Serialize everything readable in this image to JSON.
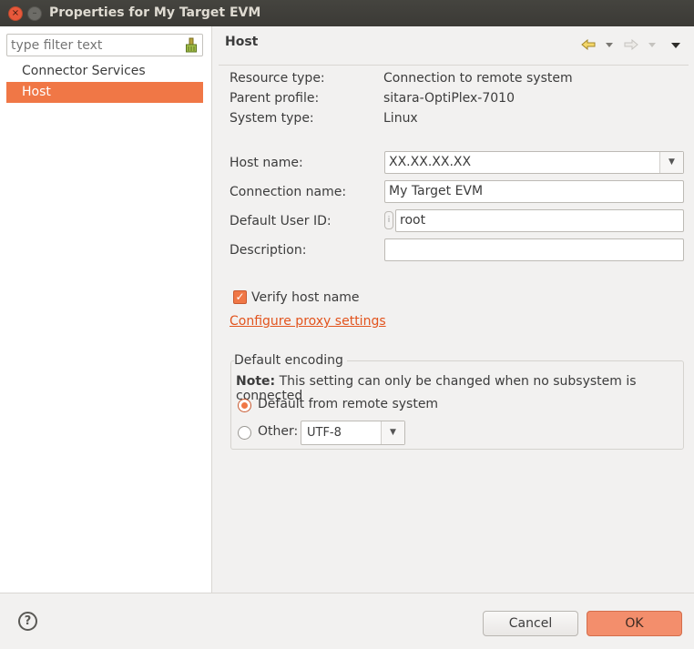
{
  "window": {
    "title": "Properties for My Target EVM",
    "close_glyph": "×",
    "minimize_glyph": "–"
  },
  "sidebar": {
    "filter_placeholder": "type filter text",
    "items": [
      {
        "label": "Connector Services",
        "selected": false
      },
      {
        "label": "Host",
        "selected": true
      }
    ]
  },
  "page": {
    "title": "Host",
    "nav_icons": [
      "back-arrow-icon",
      "dropdown-icon",
      "forward-arrow-icon",
      "dropdown-icon",
      "menu-icon"
    ]
  },
  "info": {
    "resource_type_label": "Resource type:",
    "resource_type_value": "Connection to remote system",
    "parent_profile_label": "Parent profile:",
    "parent_profile_value": "sitara-OptiPlex-7010",
    "system_type_label": "System type:",
    "system_type_value": "Linux"
  },
  "form": {
    "host_name_label": "Host name:",
    "host_name_value": "XX.XX.XX.XX",
    "connection_name_label": "Connection name:",
    "connection_name_value": "My Target EVM",
    "default_user_id_label": "Default User ID:",
    "default_user_id_value": "root",
    "description_label": "Description:",
    "description_value": ""
  },
  "verify": {
    "label": "Verify host name",
    "checked": true
  },
  "proxy_link": "Configure proxy settings",
  "encoding": {
    "group_title": "Default encoding",
    "note_bold": "Note:",
    "note_text": "This setting can only be changed when no subsystem is connected",
    "option_default": "Default from remote system",
    "option_other": "Other:",
    "selected": "default",
    "other_value": "UTF-8"
  },
  "footer": {
    "help_glyph": "?",
    "cancel_label": "Cancel",
    "ok_label": "OK"
  },
  "colors": {
    "accent": "#f07746",
    "titlebar": "#3c3b37",
    "link": "#e2541e"
  }
}
